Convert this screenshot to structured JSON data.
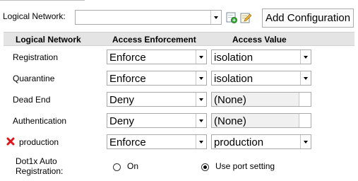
{
  "toolbar": {
    "logical_network_label": "Logical Network:",
    "logical_network_value": "",
    "add_configuration_label": "Add Configuration"
  },
  "table": {
    "headers": [
      "Logical Network",
      "Access Enforcement",
      "Access Value"
    ],
    "rows": [
      {
        "network": "Registration",
        "enforcement": "Enforce",
        "value": "isolation",
        "value_enabled": true
      },
      {
        "network": "Quarantine",
        "enforcement": "Enforce",
        "value": "isolation",
        "value_enabled": true
      },
      {
        "network": "Dead End",
        "enforcement": "Deny",
        "value": "(None)",
        "value_enabled": false
      },
      {
        "network": "Authentication",
        "enforcement": "Deny",
        "value": "(None)",
        "value_enabled": false
      },
      {
        "network": "production",
        "enforcement": "Enforce",
        "value": "production",
        "value_enabled": true,
        "deletable": true
      }
    ]
  },
  "dot1x": {
    "label_line1": "Dot1x Auto",
    "label_line2": "Registration:",
    "options": [
      {
        "label": "On",
        "checked": false
      },
      {
        "label": "Use port setting",
        "checked": true
      }
    ]
  },
  "colors": {
    "header_bg": "#e4e4e4",
    "delete_icon": "#d9161b"
  }
}
